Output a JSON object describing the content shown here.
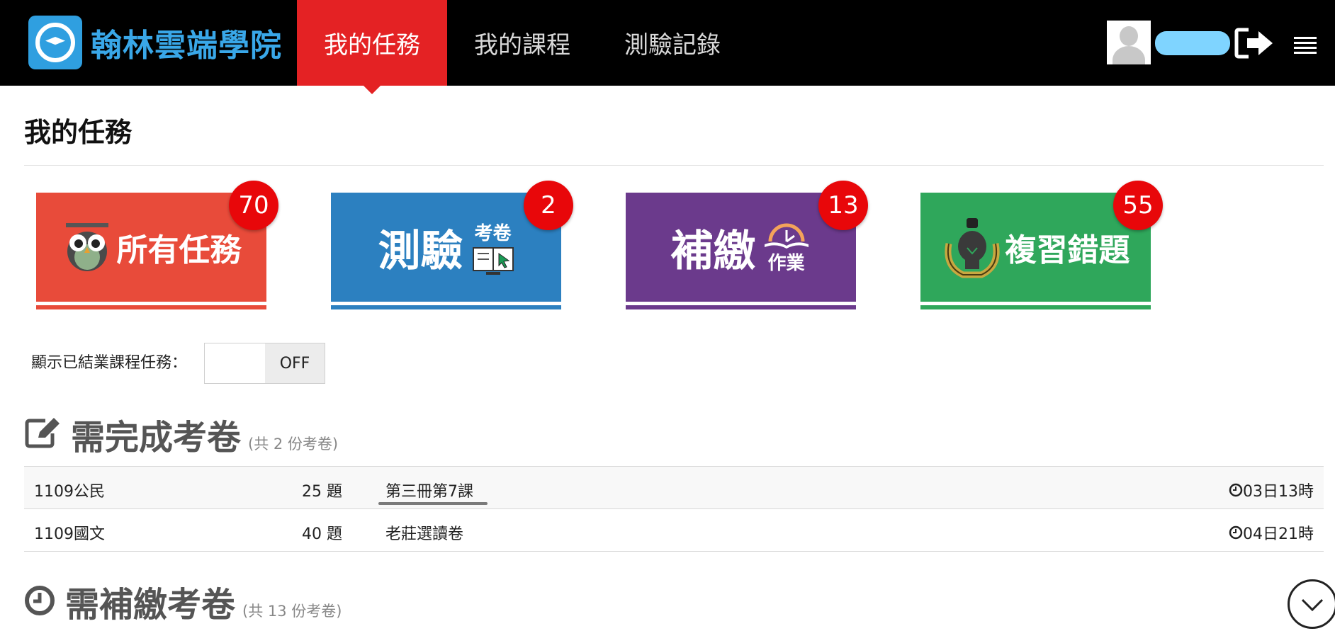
{
  "header": {
    "logo_text": "翰林雲端學院",
    "tabs": [
      {
        "label": "我的任務",
        "active": true
      },
      {
        "label": "我的課程",
        "active": false
      },
      {
        "label": "測驗記錄",
        "active": false
      }
    ],
    "icons": [
      "avatar-icon",
      "logout-icon",
      "hamburger-menu-icon"
    ]
  },
  "page": {
    "title": "我的任務"
  },
  "cards": [
    {
      "label": "所有任務",
      "count": "70",
      "color": "#e84b3a",
      "icon": "owl-icon"
    },
    {
      "label": "測驗",
      "sublabel": "考卷",
      "count": "2",
      "color": "#2c80c0",
      "icon": "book-screen-icon"
    },
    {
      "label": "補繳",
      "sublabel": "作業",
      "count": "13",
      "color": "#6b3a8c",
      "icon": "clock-book-icon"
    },
    {
      "label": "複習錯題",
      "count": "55",
      "color": "#2fa75b",
      "icon": "lightbulb-icon"
    }
  ],
  "toggle": {
    "label": "顯示已結業課程任務：",
    "state": "OFF"
  },
  "section_todo": {
    "title": "需完成考卷",
    "count_text": "(共 2 份考卷)",
    "rows": [
      {
        "course": "1109公民",
        "questions": "25 題",
        "name": "第三冊第7課",
        "remaining": "03日13時"
      },
      {
        "course": "1109國文",
        "questions": "40 題",
        "name": "老莊選讀卷",
        "remaining": "04日21時"
      }
    ]
  },
  "section_late": {
    "title": "需補繳考卷",
    "count_text": "(共 13 份考卷)"
  }
}
